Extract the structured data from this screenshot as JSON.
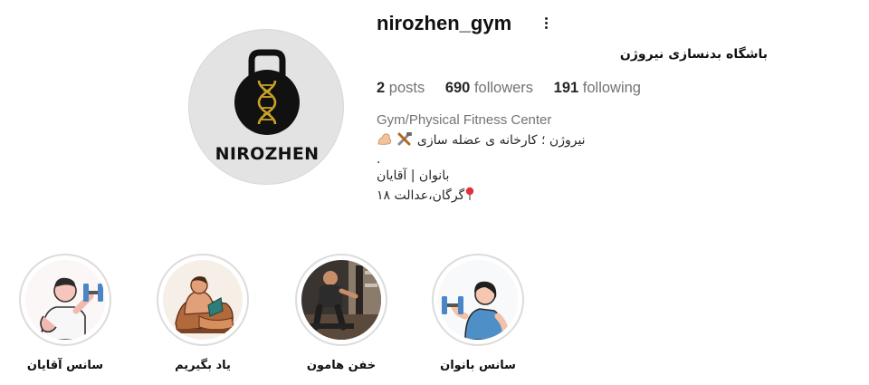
{
  "profile": {
    "username": "nirozhen_gym",
    "full_name": "باشگاه بدنسازی نیروژن",
    "avatar_logo_text": "NIROZHEN",
    "stats": {
      "posts_count": "2",
      "posts_label": "posts",
      "followers_count": "690",
      "followers_label": "followers",
      "following_count": "191",
      "following_label": "following"
    },
    "category": "Gym/Physical Fitness Center",
    "bio": {
      "line1": "نیروژن ؛ کارخانه ی عضله سازی",
      "line2": ".",
      "line3": "بانوان | آقایان",
      "line4": "گرگان،عدالت ۱۸"
    }
  },
  "icons": {
    "options": "more-vertical-icon",
    "tools": "tools-emoji-icon",
    "muscle": "flexed-biceps-emoji-icon",
    "location": "round-pushpin-icon"
  },
  "highlights": [
    {
      "label": "سانس آقایان",
      "icon": "man-dumbbell-illustration"
    },
    {
      "label": "یاد بگیریم",
      "icon": "muscular-man-reading-illustration"
    },
    {
      "label": "خفن هامون",
      "icon": "gym-photo"
    },
    {
      "label": "سانس بانوان",
      "icon": "woman-dumbbell-illustration"
    }
  ],
  "colors": {
    "text_primary": "#262626",
    "text_secondary": "#737373",
    "highlight_ring": "#dcdcdc",
    "logo_gold": "#c9a227"
  }
}
